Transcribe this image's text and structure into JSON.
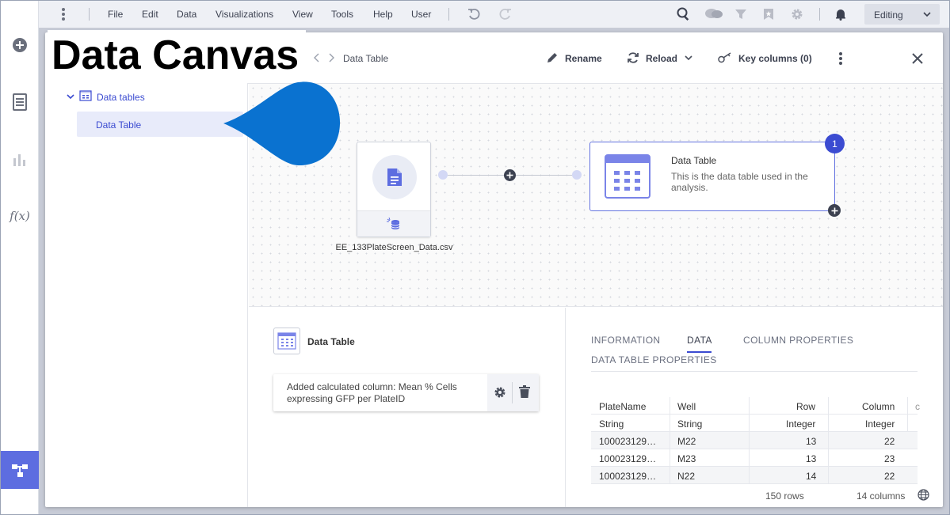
{
  "menubar": {
    "items": [
      "File",
      "Edit",
      "Data",
      "Visualizations",
      "View",
      "Tools",
      "Help",
      "User"
    ],
    "mode": "Editing"
  },
  "overlay_title": "Data Canvas",
  "header": {
    "title": "Data Table",
    "rename_label": "Rename",
    "reload_label": "Reload",
    "key_columns_label": "Key columns (0)"
  },
  "tree": {
    "group_label": "Data tables",
    "item_label": "Data Table"
  },
  "canvas": {
    "source_label": "EE_133PlateScreen_Data.csv",
    "target_title": "Data Table",
    "target_desc": "This is the data table used in the analysis.",
    "badge": "1"
  },
  "details": {
    "title": "Data Table",
    "step_text": "Added calculated column: Mean % Cells expressing GFP per PlateID"
  },
  "tabs": {
    "information": "INFORMATION",
    "data": "DATA",
    "column_properties": "COLUMN PROPERTIES",
    "data_table_properties": "DATA TABLE PROPERTIES"
  },
  "table": {
    "headers": [
      "PlateName",
      "Well",
      "Row",
      "Column"
    ],
    "types": [
      "String",
      "String",
      "Integer",
      "Integer"
    ],
    "rows": [
      [
        "100023129…",
        "M22",
        "13",
        "22"
      ],
      [
        "100023129…",
        "M23",
        "13",
        "23"
      ],
      [
        "100023129…",
        "N22",
        "14",
        "22"
      ]
    ],
    "rows_count": "150 rows",
    "columns_count": "14 columns"
  },
  "colors": {
    "accent": "#3b4bd1",
    "rail_active": "#5d6de0",
    "drop": "#0a72d0"
  }
}
